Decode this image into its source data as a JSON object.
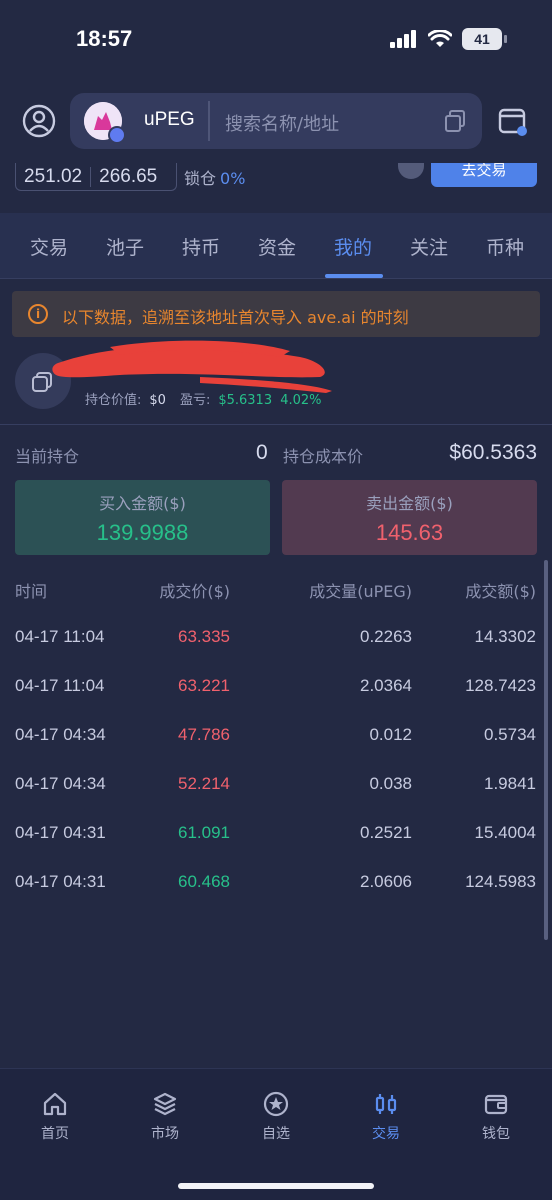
{
  "status_bar": {
    "time": "18:57",
    "battery": "41"
  },
  "header": {
    "token_name": "uPEG",
    "search_placeholder": "搜索名称/地址"
  },
  "price_row": {
    "low": "251.02",
    "high": "266.65",
    "lock_label": "锁仓",
    "lock_value": "0%",
    "trade_button": "去交易"
  },
  "tabs": [
    {
      "label": "交易"
    },
    {
      "label": "池子"
    },
    {
      "label": "持币"
    },
    {
      "label": "资金"
    },
    {
      "label": "我的",
      "active": true
    },
    {
      "label": "关注"
    },
    {
      "label": "币种"
    }
  ],
  "notice": {
    "text": "以下数据，追溯至该地址首次导入 ave.ai 的时刻"
  },
  "holding": {
    "value_label": "持仓价值:",
    "value": "$0",
    "pnl_label": "盈亏:",
    "pnl_value": "$5.6313",
    "pnl_pct": "4.02%"
  },
  "position": {
    "current_label": "当前持仓",
    "current_value": "0",
    "cost_label": "持仓成本价",
    "cost_value": "$60.5363"
  },
  "summary": {
    "buy_label": "买入金额($)",
    "buy_value": "139.9988",
    "sell_label": "卖出金额($)",
    "sell_value": "145.63"
  },
  "table": {
    "headers": {
      "time": "时间",
      "price": "成交价($)",
      "qty": "成交量(uPEG)",
      "amount": "成交额($)"
    },
    "rows": [
      {
        "time": "04-17 11:04",
        "price": "63.335",
        "qty": "0.2263",
        "amount": "14.3302",
        "side": "sell"
      },
      {
        "time": "04-17 11:04",
        "price": "63.221",
        "qty": "2.0364",
        "amount": "128.7423",
        "side": "sell"
      },
      {
        "time": "04-17 04:34",
        "price": "47.786",
        "qty": "0.012",
        "amount": "0.5734",
        "side": "sell"
      },
      {
        "time": "04-17 04:34",
        "price": "52.214",
        "qty": "0.038",
        "amount": "1.9841",
        "side": "sell"
      },
      {
        "time": "04-17 04:31",
        "price": "61.091",
        "qty": "0.2521",
        "amount": "15.4004",
        "side": "buy"
      },
      {
        "time": "04-17 04:31",
        "price": "60.468",
        "qty": "2.0606",
        "amount": "124.5983",
        "side": "buy"
      }
    ]
  },
  "bottom_nav": [
    {
      "label": "首页",
      "icon": "home-icon"
    },
    {
      "label": "市场",
      "icon": "layers-icon"
    },
    {
      "label": "自选",
      "icon": "star-icon"
    },
    {
      "label": "交易",
      "icon": "candlestick-icon",
      "active": true
    },
    {
      "label": "钱包",
      "icon": "wallet-icon"
    }
  ],
  "colors": {
    "background": "#232943",
    "accent": "#5b8def",
    "up": "#27c08a",
    "down": "#f0616d",
    "warning": "#e8862e"
  }
}
